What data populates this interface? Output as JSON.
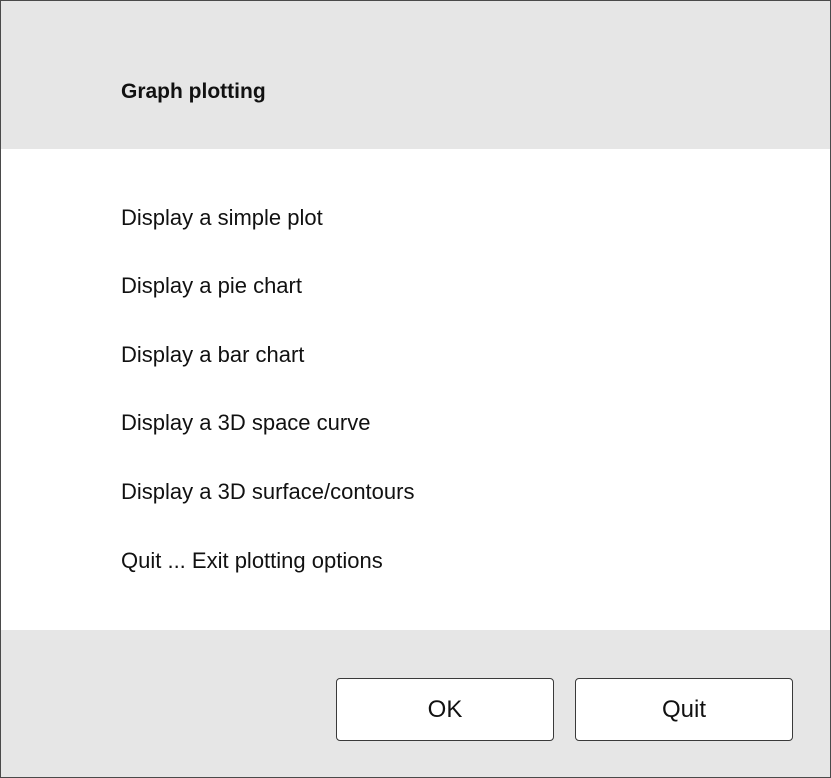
{
  "dialog": {
    "title": "Graph plotting",
    "options": [
      "Display a simple plot",
      "Display a pie chart",
      "Display a bar chart",
      "Display a 3D space curve",
      "Display a 3D surface/contours",
      "Quit ... Exit plotting options"
    ],
    "buttons": {
      "ok_label": "OK",
      "quit_label": "Quit"
    }
  },
  "colors": {
    "header_background": "#e6e6e6",
    "footer_background": "#e6e6e6",
    "content_background": "#ffffff",
    "border": "#4a4a4a",
    "text": "#111111"
  }
}
